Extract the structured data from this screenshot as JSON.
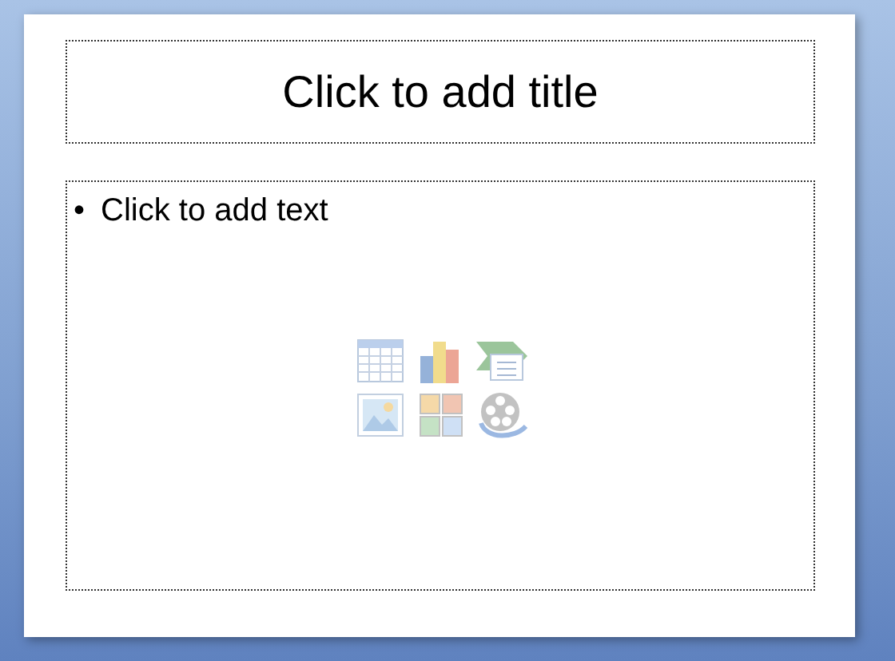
{
  "slide": {
    "title_placeholder": "Click to add title",
    "body_placeholder": {
      "bullet": "•",
      "text": "Click to add text"
    },
    "content_icons": [
      {
        "kind": "table"
      },
      {
        "kind": "chart"
      },
      {
        "kind": "smartart"
      },
      {
        "kind": "picture"
      },
      {
        "kind": "clipart"
      },
      {
        "kind": "media"
      }
    ]
  }
}
